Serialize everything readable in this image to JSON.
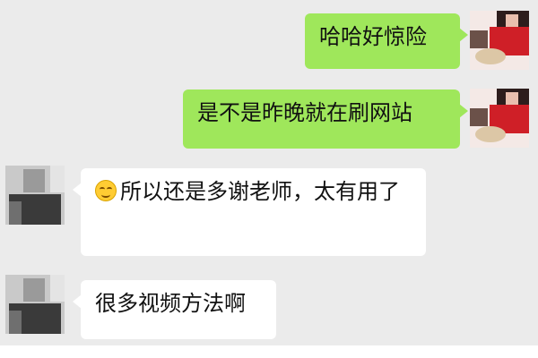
{
  "chat": {
    "messages": [
      {
        "side": "out",
        "text": "哈哈好惊险"
      },
      {
        "side": "out",
        "text": "是不是昨晚就在刷网站"
      },
      {
        "side": "in",
        "emoji": "smile",
        "text": "所以还是多谢老师，太有用了"
      },
      {
        "side": "in",
        "text": "很多视频方法啊"
      }
    ]
  },
  "colors": {
    "chat_background": "#ebebeb",
    "outgoing_bubble": "#9fe75b",
    "incoming_bubble": "#ffffff"
  }
}
